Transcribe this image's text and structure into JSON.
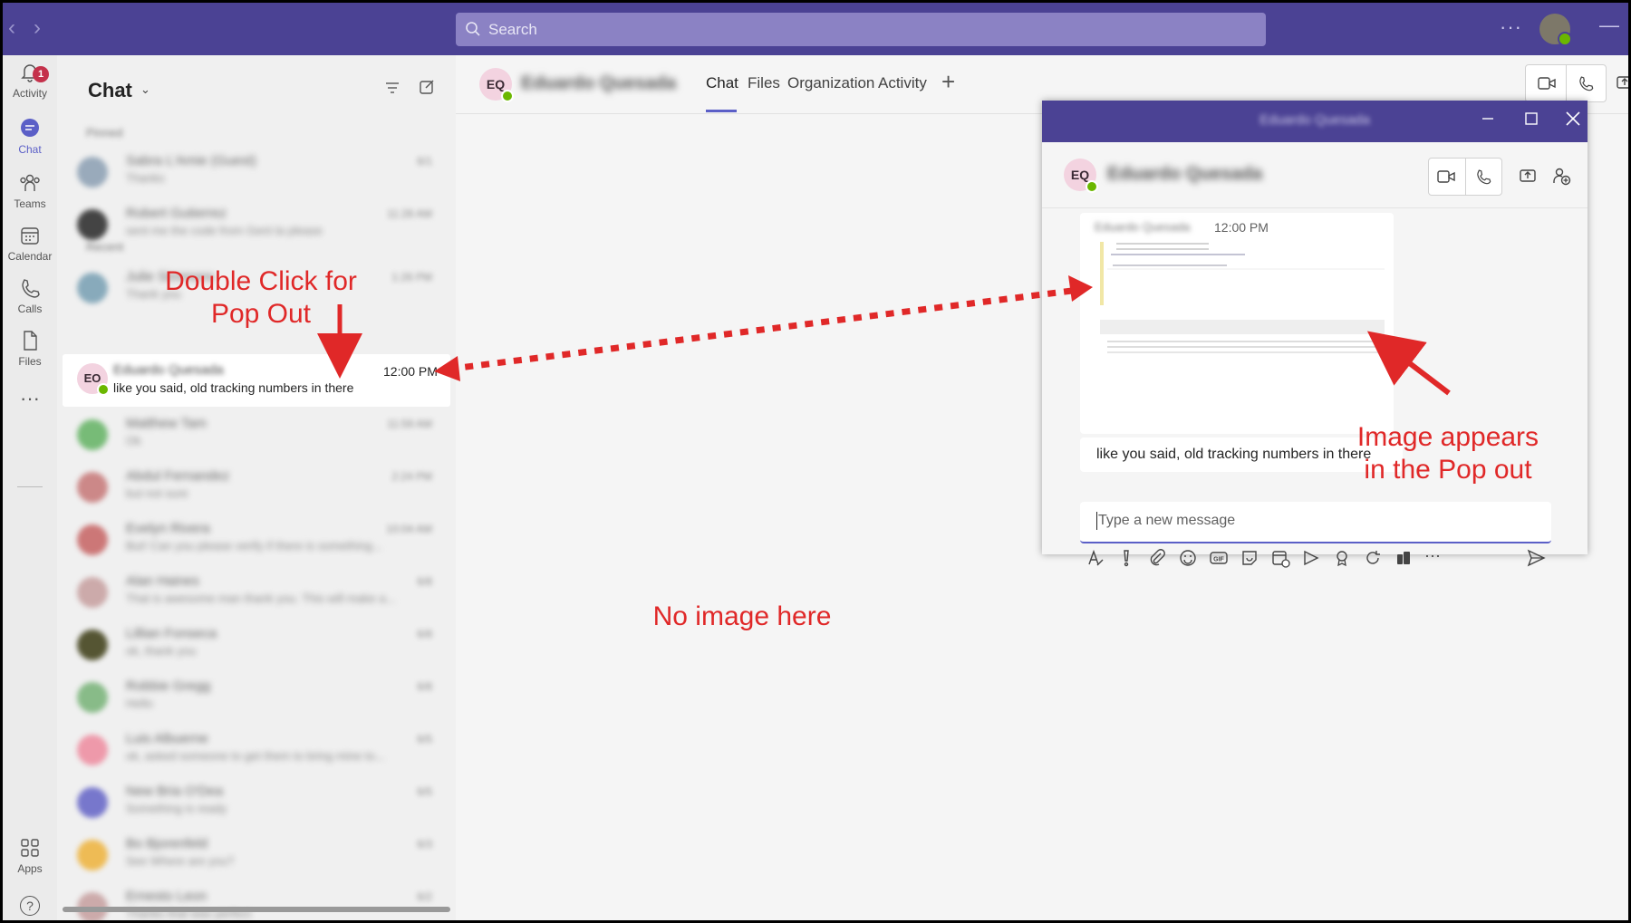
{
  "topbar": {
    "search_placeholder": "Search",
    "more_label": "···",
    "minimize_label": "—"
  },
  "rail": {
    "activity_label": "Activity",
    "activity_badge": "1",
    "chat_label": "Chat",
    "teams_label": "Teams",
    "calendar_label": "Calendar",
    "calls_label": "Calls",
    "files_label": "Files",
    "more_label": "···",
    "apps_label": "Apps",
    "help_label": "?"
  },
  "chatlist": {
    "title": "Chat",
    "pinned_label": "Pinned",
    "recent_label": "Recent",
    "active": {
      "initials": "EO",
      "name": "Eduardo Quesada",
      "time": "12:00 PM",
      "preview": "like you said, old tracking numbers in there"
    },
    "pinned_rows": [
      {
        "name": "Sabra L'Amie (Guest)",
        "preview": "Thanks",
        "time": "6/1",
        "color": "#9ab"
      },
      {
        "name": "Robert Gutierrez",
        "preview": "sent me the code from Gent la please",
        "time": "11:28 AM",
        "color": "#444"
      }
    ],
    "recent_rows": [
      {
        "name": "Julie Simmons",
        "preview": "Thank you",
        "time": "1:26 PM",
        "color": "#8ab"
      },
      {
        "name": "Matthew Tam",
        "preview": "Ok",
        "time": "11:59 AM",
        "color": "#7b7"
      },
      {
        "name": "Abdul Fernandez",
        "preview": "but not sure",
        "time": "2:24 PM",
        "color": "#c88"
      },
      {
        "name": "Evelyn Rivera",
        "preview": "But! Can you please verify if there is something...",
        "time": "10:04 AM",
        "color": "#c77"
      },
      {
        "name": "Alan Haines",
        "preview": "That is awesome man thank you. This will make a...",
        "time": "6/8",
        "color": "#caa"
      },
      {
        "name": "Lillian Fonseca",
        "preview": "ok, thank you",
        "time": "6/8",
        "color": "#553"
      },
      {
        "name": "Robbie Gregg",
        "preview": "Hello",
        "time": "6/8",
        "color": "#8b8"
      },
      {
        "name": "Luis Albuerne",
        "preview": "ok, asked someone to get them to bring mine to...",
        "time": "6/5",
        "color": "#e9a"
      },
      {
        "name": "New Bria O'Dea",
        "preview": "Something is ready",
        "time": "6/5",
        "color": "#77c"
      },
      {
        "name": "Bo Bjorenfeld",
        "preview": "See Where are you?",
        "time": "6/3",
        "color": "#eb5"
      },
      {
        "name": "Ernesto Leon",
        "preview": "Thanks that was perfect",
        "time": "6/2",
        "color": "#caa"
      }
    ]
  },
  "main": {
    "initials": "EQ",
    "name": "Eduardo Quesada",
    "tabs": [
      "Chat",
      "Files",
      "Organization",
      "Activity"
    ],
    "add_tab": "+"
  },
  "popout": {
    "window_title": "Eduardo Quesada",
    "initials": "EQ",
    "name": "Eduardo Quesada",
    "sender": "Eduardo Quesada",
    "time": "12:00 PM",
    "message": "like you said, old tracking numbers in there",
    "compose_placeholder": "Type a new message",
    "toolbar_more": "···"
  },
  "annotations": {
    "double_click_line1": "Double Click for",
    "double_click_line2": "Pop Out",
    "no_image": "No image here",
    "image_appears_line1": "Image appears",
    "image_appears_line2": "in the Pop out",
    "color": "#e02828"
  }
}
